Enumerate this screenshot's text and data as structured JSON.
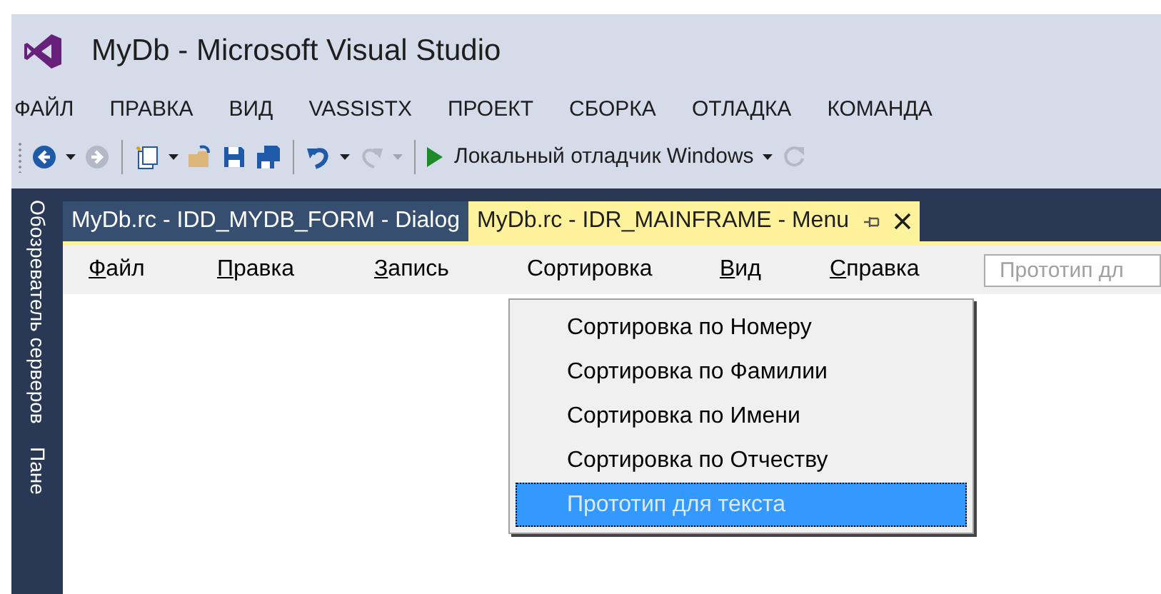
{
  "window": {
    "title": "MyDb - Microsoft Visual Studio"
  },
  "menu": [
    "ФАЙЛ",
    "ПРАВКА",
    "ВИД",
    "VASSISTX",
    "ПРОЕКТ",
    "СБОРКА",
    "ОТЛАДКА",
    "КОМАНДА"
  ],
  "toolbar": [
    {
      "kind": "back",
      "disabled": false
    },
    {
      "kind": "caret",
      "disabled": false
    },
    {
      "kind": "forward",
      "disabled": true
    },
    {
      "kind": "sep"
    },
    {
      "kind": "new",
      "disabled": false
    },
    {
      "kind": "caret",
      "disabled": false
    },
    {
      "kind": "open",
      "disabled": false
    },
    {
      "kind": "save",
      "disabled": false
    },
    {
      "kind": "saveall",
      "disabled": false
    },
    {
      "kind": "sep"
    },
    {
      "kind": "undo",
      "disabled": false
    },
    {
      "kind": "caret",
      "disabled": false
    },
    {
      "kind": "redo",
      "disabled": true
    },
    {
      "kind": "caret",
      "disabled": true
    },
    {
      "kind": "sep"
    },
    {
      "kind": "run",
      "label": "Локальный отладчик Windows"
    },
    {
      "kind": "caret",
      "disabled": false
    },
    {
      "kind": "refresh",
      "disabled": true
    }
  ],
  "side_panels": [
    "Обозреватель серверов",
    "Пане"
  ],
  "tabs": [
    {
      "label": "MyDb.rc - IDD_MYDB_FORM - Dialog",
      "selected": false
    },
    {
      "label": "MyDb.rc - IDR_MAINFRAME - Menu",
      "selected": true
    }
  ],
  "designer_menu": [
    {
      "label": "Файл",
      "mnemonic": true
    },
    {
      "label": "Правка",
      "mnemonic": true
    },
    {
      "label": "Запись",
      "mnemonic": true
    },
    {
      "label": "Сортировка",
      "mnemonic": false
    },
    {
      "label": "Вид",
      "mnemonic": true
    },
    {
      "label": "Справка",
      "mnemonic": true
    }
  ],
  "designer_new_item": {
    "placeholder": "Прототип дл"
  },
  "dropdown": [
    {
      "label": "Сортировка по Номеру",
      "selected": false,
      "kind": "item"
    },
    {
      "label": "Сортировка по Фамилии",
      "selected": false,
      "kind": "item"
    },
    {
      "label": "Сортировка по Имени",
      "selected": false,
      "kind": "item"
    },
    {
      "label": "Сортировка по Отчеству",
      "selected": false,
      "kind": "item"
    },
    {
      "label": "Прототип для текста",
      "selected": true,
      "kind": "prototype"
    }
  ]
}
